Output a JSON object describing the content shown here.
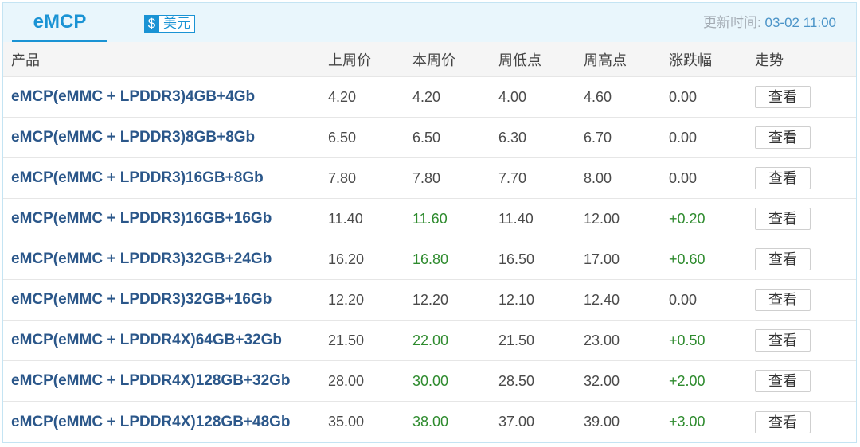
{
  "header": {
    "tab_label": "eMCP",
    "currency": {
      "symbol": "$",
      "label": "美元"
    },
    "update": {
      "label": "更新时间:",
      "time": "03-02 11:00"
    }
  },
  "table": {
    "columns": [
      "产品",
      "上周价",
      "本周价",
      "周低点",
      "周高点",
      "涨跌幅",
      "走势"
    ],
    "rows": [
      {
        "product": "eMCP(eMMC + LPDDR3)4GB+4Gb",
        "last_week": "4.20",
        "this_week": "4.20",
        "week_low": "4.00",
        "week_high": "4.60",
        "change": "0.00",
        "action": "查看"
      },
      {
        "product": "eMCP(eMMC + LPDDR3)8GB+8Gb",
        "last_week": "6.50",
        "this_week": "6.50",
        "week_low": "6.30",
        "week_high": "6.70",
        "change": "0.00",
        "action": "查看"
      },
      {
        "product": "eMCP(eMMC + LPDDR3)16GB+8Gb",
        "last_week": "7.80",
        "this_week": "7.80",
        "week_low": "7.70",
        "week_high": "8.00",
        "change": "0.00",
        "action": "查看"
      },
      {
        "product": "eMCP(eMMC + LPDDR3)16GB+16Gb",
        "last_week": "11.40",
        "this_week": "11.60",
        "week_low": "11.40",
        "week_high": "12.00",
        "change": "+0.20",
        "action": "查看"
      },
      {
        "product": "eMCP(eMMC + LPDDR3)32GB+24Gb",
        "last_week": "16.20",
        "this_week": "16.80",
        "week_low": "16.50",
        "week_high": "17.00",
        "change": "+0.60",
        "action": "查看"
      },
      {
        "product": "eMCP(eMMC + LPDDR3)32GB+16Gb",
        "last_week": "12.20",
        "this_week": "12.20",
        "week_low": "12.10",
        "week_high": "12.40",
        "change": "0.00",
        "action": "查看"
      },
      {
        "product": "eMCP(eMMC + LPDDR4X)64GB+32Gb",
        "last_week": "21.50",
        "this_week": "22.00",
        "week_low": "21.50",
        "week_high": "23.00",
        "change": "+0.50",
        "action": "查看"
      },
      {
        "product": "eMCP(eMMC + LPDDR4X)128GB+32Gb",
        "last_week": "28.00",
        "this_week": "30.00",
        "week_low": "28.50",
        "week_high": "32.00",
        "change": "+2.00",
        "action": "查看"
      },
      {
        "product": "eMCP(eMMC + LPDDR4X)128GB+48Gb",
        "last_week": "35.00",
        "this_week": "38.00",
        "week_low": "37.00",
        "week_high": "39.00",
        "change": "+3.00",
        "action": "查看"
      }
    ]
  },
  "colors": {
    "accent": "#1a93d4",
    "header_bg": "#e9f6fc",
    "border": "#c4e4f3",
    "product_text": "#2b578a",
    "rise": "#2e8b2e"
  }
}
